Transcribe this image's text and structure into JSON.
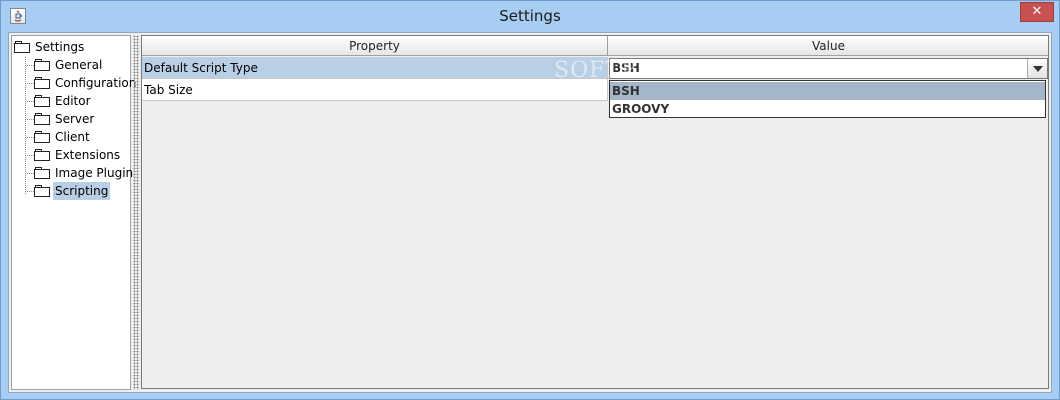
{
  "window": {
    "title": "Settings",
    "close_glyph": "✕"
  },
  "tree": {
    "root": "Settings",
    "items": [
      "General",
      "Configuration",
      "Editor",
      "Server",
      "Client",
      "Extensions",
      "Image Plugin",
      "Scripting"
    ]
  },
  "table": {
    "headers": {
      "property": "Property",
      "value": "Value"
    },
    "rows": [
      {
        "property": "Default Script Type",
        "value": "BSH"
      },
      {
        "property": "Tab Size",
        "value": ""
      }
    ]
  },
  "dropdown": {
    "options": [
      "BSH",
      "GROOVY"
    ],
    "highlighted": "BSH"
  },
  "watermark": {
    "text": "SOFTPEDIA"
  },
  "colors": {
    "selection": "#b8cfe5",
    "dropdown_highlight": "#a5b6c9",
    "title_bar": "#a8cdf2",
    "close_button": "#c75050"
  }
}
